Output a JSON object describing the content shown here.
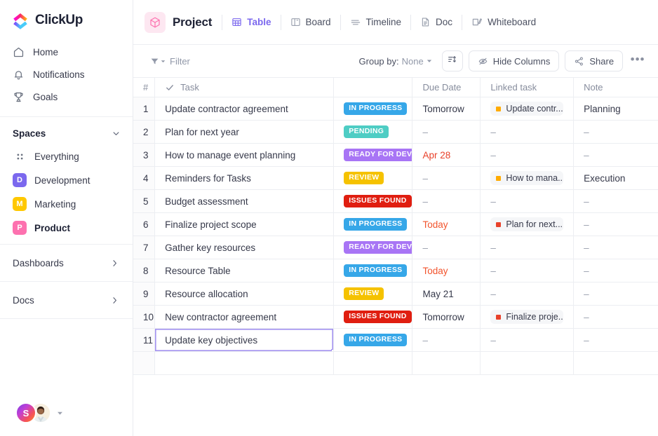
{
  "brand": {
    "name": "ClickUp",
    "logo_icon": "clickup-logo-icon"
  },
  "sidebar": {
    "nav": [
      {
        "label": "Home",
        "icon": "home-icon"
      },
      {
        "label": "Notifications",
        "icon": "bell-icon"
      },
      {
        "label": "Goals",
        "icon": "trophy-icon"
      }
    ],
    "spaces_title": "Spaces",
    "spaces": [
      {
        "label": "Everything",
        "badge": "",
        "color": "",
        "icon": "grid-dots-icon",
        "active": false
      },
      {
        "label": "Development",
        "badge": "D",
        "color": "#7b68ee",
        "active": false
      },
      {
        "label": "Marketing",
        "badge": "M",
        "color": "#ffc800",
        "active": false
      },
      {
        "label": "Product",
        "badge": "P",
        "color": "#fd71af",
        "active": true
      }
    ],
    "footer": [
      {
        "label": "Dashboards",
        "icon": "chevron-right-icon"
      },
      {
        "label": "Docs",
        "icon": "chevron-right-icon"
      }
    ],
    "user": {
      "initial": "S",
      "avatar_icon": "user-avatar",
      "caret_icon": "chevron-down-icon"
    }
  },
  "header": {
    "project_icon": "cube-icon",
    "project_title": "Project",
    "views": [
      {
        "label": "Table",
        "icon": "table-icon",
        "active": true
      },
      {
        "label": "Board",
        "icon": "board-icon",
        "active": false
      },
      {
        "label": "Timeline",
        "icon": "timeline-icon",
        "active": false
      },
      {
        "label": "Doc",
        "icon": "doc-icon",
        "active": false
      },
      {
        "label": "Whiteboard",
        "icon": "whiteboard-icon",
        "active": false
      }
    ]
  },
  "toolbar": {
    "filter_label": "Filter",
    "filter_icon": "funnel-icon",
    "group_by_label": "Group by:",
    "group_by_value": "None",
    "sort_icon": "sort-icon",
    "hide_columns_label": "Hide Columns",
    "hide_columns_icon": "eye-off-icon",
    "share_label": "Share",
    "share_icon": "share-icon",
    "more_label": "•••"
  },
  "table": {
    "columns": [
      {
        "key": "num",
        "label": "#"
      },
      {
        "key": "task",
        "label": "Task",
        "icon": "check-icon"
      },
      {
        "key": "status",
        "label": ""
      },
      {
        "key": "due",
        "label": "Due Date"
      },
      {
        "key": "linked",
        "label": "Linked task"
      },
      {
        "key": "note",
        "label": "Note"
      }
    ],
    "dash": "–",
    "status_colors": {
      "IN PROGRESS": "#36a7e8",
      "PENDING": "#4ecdc4",
      "READY FOR DEV": "#a875f5",
      "REVIEW": "#f5c200",
      "ISSUES FOUND": "#e01e10"
    },
    "rows": [
      {
        "num": "1",
        "task": "Update contractor agreement",
        "status": "IN PROGRESS",
        "due": "Tomorrow",
        "due_style": "normal",
        "linked": "Update contr...",
        "linked_dot": "#ffab00",
        "note": "Planning",
        "selected": false
      },
      {
        "num": "2",
        "task": "Plan for next year",
        "status": "PENDING",
        "due": "–",
        "due_style": "dash",
        "linked": "",
        "linked_dot": "",
        "note": "–",
        "selected": false
      },
      {
        "num": "3",
        "task": "How to manage event planning",
        "status": "READY FOR DEV",
        "due": "Apr 28",
        "due_style": "over",
        "linked": "",
        "linked_dot": "",
        "note": "–",
        "selected": false
      },
      {
        "num": "4",
        "task": "Reminders for Tasks",
        "status": "REVIEW",
        "due": "–",
        "due_style": "dash",
        "linked": "How to mana...",
        "linked_dot": "#ffab00",
        "note": "Execution",
        "selected": false
      },
      {
        "num": "5",
        "task": "Budget assessment",
        "status": "ISSUES FOUND",
        "due": "–",
        "due_style": "dash",
        "linked": "",
        "linked_dot": "",
        "note": "–",
        "selected": false
      },
      {
        "num": "6",
        "task": "Finalize project scope",
        "status": "IN PROGRESS",
        "due": "Today",
        "due_style": "soon",
        "linked": "Plan for next...",
        "linked_dot": "#e8412a",
        "note": "–",
        "selected": false
      },
      {
        "num": "7",
        "task": "Gather key resources",
        "status": "READY FOR DEV",
        "due": "–",
        "due_style": "dash",
        "linked": "",
        "linked_dot": "",
        "note": "–",
        "selected": false
      },
      {
        "num": "8",
        "task": "Resource Table",
        "status": "IN PROGRESS",
        "due": "Today",
        "due_style": "soon",
        "linked": "",
        "linked_dot": "",
        "note": "–",
        "selected": false
      },
      {
        "num": "9",
        "task": "Resource allocation",
        "status": "REVIEW",
        "due": "May 21",
        "due_style": "normal",
        "linked": "",
        "linked_dot": "",
        "note": "–",
        "selected": false
      },
      {
        "num": "10",
        "task": "New contractor agreement",
        "status": "ISSUES FOUND",
        "due": "Tomorrow",
        "due_style": "normal",
        "linked": "Finalize proje...",
        "linked_dot": "#e8412a",
        "note": "–",
        "selected": false
      },
      {
        "num": "11",
        "task": "Update key objectives",
        "status": "IN PROGRESS",
        "due": "–",
        "due_style": "dash",
        "linked": "",
        "linked_dot": "",
        "note": "–",
        "selected": true
      }
    ]
  }
}
